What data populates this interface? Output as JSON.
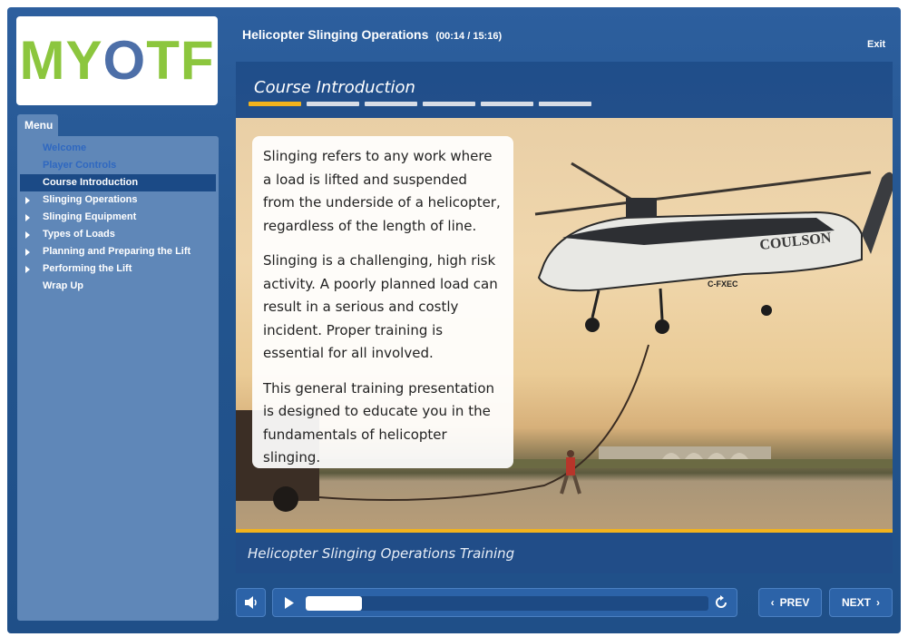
{
  "course": {
    "title": "Helicopter Slinging Operations",
    "time": "(00:14 / 15:16)",
    "exit_label": "Exit"
  },
  "logo": {
    "text_m": "M",
    "text_y": "Y",
    "text_o": "O",
    "text_tf": "TF"
  },
  "menu": {
    "tab_label": "Menu",
    "items": [
      {
        "label": "Welcome",
        "state": "visited",
        "has_children": false
      },
      {
        "label": "Player Controls",
        "state": "visited",
        "has_children": false
      },
      {
        "label": "Course Introduction",
        "state": "active",
        "has_children": false
      },
      {
        "label": "Slinging Operations",
        "state": "normal",
        "has_children": true
      },
      {
        "label": "Slinging Equipment",
        "state": "normal",
        "has_children": true
      },
      {
        "label": "Types of Loads",
        "state": "normal",
        "has_children": true
      },
      {
        "label": "Planning and Preparing the Lift",
        "state": "normal",
        "has_children": true
      },
      {
        "label": "Performing the Lift",
        "state": "normal",
        "has_children": true
      },
      {
        "label": "Wrap Up",
        "state": "normal",
        "has_children": false
      }
    ]
  },
  "section": {
    "title": "Course Introduction",
    "segments_total": 6,
    "segments_done": 1
  },
  "slide": {
    "paragraphs": [
      "Slinging refers to any work where a load is lifted and suspended from the underside of a helicopter, regardless of the length of line.",
      "Slinging is a challenging, high risk activity. A poorly planned load can result in a serious and costly incident. Proper training is essential for all involved.",
      "This general training presentation is designed to educate you in the fundamentals of helicopter slinging."
    ],
    "helicopter_livery": "COULSON",
    "helicopter_reg": "C-FXEC"
  },
  "caption": "Helicopter Slinging Operations Training",
  "player": {
    "progress": 0.14,
    "prev_label": "PREV",
    "next_label": "NEXT"
  },
  "colors": {
    "accent": "#f2b31d",
    "panel": "#5f87b8",
    "frame": "#23558f",
    "logo_green": "#8cc63e",
    "logo_blue": "#4d6fa8"
  }
}
